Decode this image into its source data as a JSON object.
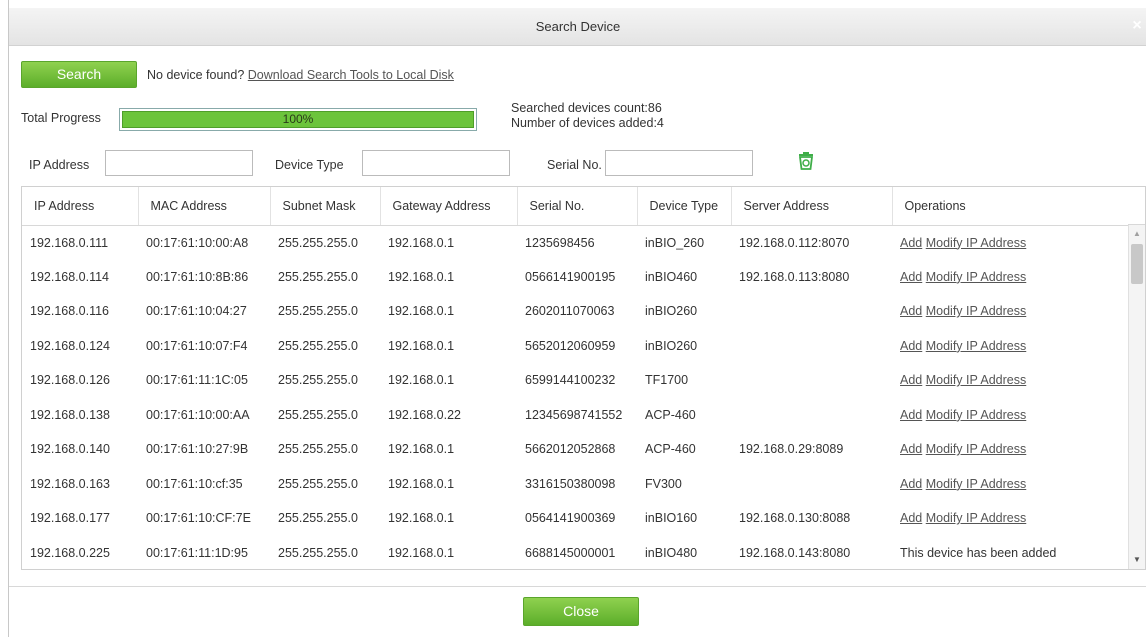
{
  "window": {
    "title": "Search Device",
    "close_glyph": "×"
  },
  "search": {
    "button_label": "Search",
    "hint_text": "No device found?",
    "download_link": "Download Search Tools to Local Disk"
  },
  "progress": {
    "label": "Total Progress",
    "value_text": "100%",
    "fraction": 1.0,
    "searched_count": "Searched devices count:86",
    "added_count": "Number of devices added:4"
  },
  "filters": {
    "ip_label": "IP Address",
    "ip_value": "",
    "type_label": "Device Type",
    "type_value": "",
    "serial_label": "Serial No.",
    "serial_value": "",
    "clear_icon": "trash-icon"
  },
  "table": {
    "columns": [
      "IP Address",
      "MAC Address",
      "Subnet Mask",
      "Gateway Address",
      "Serial No.",
      "Device Type",
      "Server Address",
      "Operations"
    ],
    "rows": [
      [
        "192.168.0.111",
        "00:17:61:10:00:A8",
        "255.255.255.0",
        "192.168.0.1",
        "1235698456",
        "inBIO_260",
        "192.168.0.112:8070",
        "ops"
      ],
      [
        "192.168.0.114",
        "00:17:61:10:8B:86",
        "255.255.255.0",
        "192.168.0.1",
        "0566141900195",
        "inBIO460",
        "192.168.0.113:8080",
        "ops"
      ],
      [
        "192.168.0.116",
        "00:17:61:10:04:27",
        "255.255.255.0",
        "192.168.0.1",
        "2602011070063",
        "inBIO260",
        "",
        "ops"
      ],
      [
        "192.168.0.124",
        "00:17:61:10:07:F4",
        "255.255.255.0",
        "192.168.0.1",
        "5652012060959",
        "inBIO260",
        "",
        "ops"
      ],
      [
        "192.168.0.126",
        "00:17:61:11:1C:05",
        "255.255.255.0",
        "192.168.0.1",
        "6599144100232",
        "TF1700",
        "",
        "ops"
      ],
      [
        "192.168.0.138",
        "00:17:61:10:00:AA",
        "255.255.255.0",
        "192.168.0.22",
        "12345698741552",
        "ACP-460",
        "",
        "ops"
      ],
      [
        "192.168.0.140",
        "00:17:61:10:27:9B",
        "255.255.255.0",
        "192.168.0.1",
        "5662012052868",
        "ACP-460",
        "192.168.0.29:8089",
        "ops"
      ],
      [
        "192.168.0.163",
        "00:17:61:10:cf:35",
        "255.255.255.0",
        "192.168.0.1",
        "3316150380098",
        "FV300",
        "",
        "ops"
      ],
      [
        "192.168.0.177",
        "00:17:61:10:CF:7E",
        "255.255.255.0",
        "192.168.0.1",
        "0564141900369",
        "inBIO160",
        "192.168.0.130:8088",
        "ops"
      ],
      [
        "192.168.0.225",
        "00:17:61:11:1D:95",
        "255.255.255.0",
        "192.168.0.1",
        "6688145000001",
        "inBIO480",
        "192.168.0.143:8080",
        "This device has been added"
      ]
    ],
    "op_add": "Add",
    "op_modify": "Modify IP Address"
  },
  "footer": {
    "close_label": "Close"
  },
  "colors": {
    "accent_green": "#6cc43b",
    "link_gray": "#555555"
  }
}
